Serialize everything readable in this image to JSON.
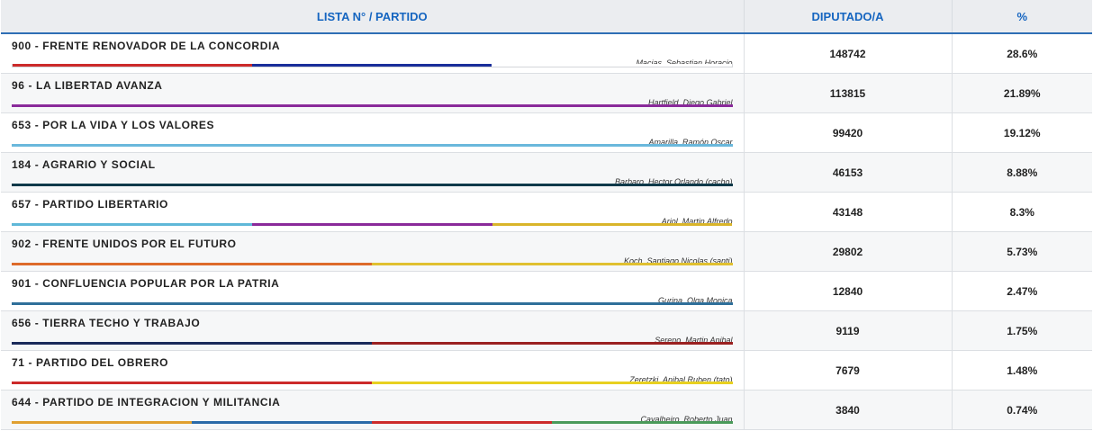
{
  "header": {
    "party_col": "LISTA N° / PARTIDO",
    "votes_col": "DIPUTADO/A",
    "pct_col": "%"
  },
  "rows": [
    {
      "party": "900 - FRENTE RENOVADOR DE LA CONCORDIA",
      "candidate": "Macias, Sebastian Horacio",
      "votes": "148742",
      "pct": "28.6%",
      "colors": [
        "#cc2a2a",
        "#1a2e9a",
        "#ffffff"
      ]
    },
    {
      "party": "96 - LA LIBERTAD AVANZA",
      "candidate": "Hartfield, Diego Gabriel",
      "votes": "113815",
      "pct": "21.89%",
      "colors": [
        "#8a2a9a"
      ]
    },
    {
      "party": "653 - POR LA VIDA Y LOS VALORES",
      "candidate": "Amarilla, Ramón Oscar",
      "votes": "99420",
      "pct": "19.12%",
      "colors": [
        "#6ab8dc"
      ]
    },
    {
      "party": "184 - AGRARIO Y SOCIAL",
      "candidate": "Barbaro, Hector Orlando (cacho)",
      "votes": "46153",
      "pct": "8.88%",
      "colors": [
        "#0f3a4a"
      ]
    },
    {
      "party": "657 - PARTIDO LIBERTARIO",
      "candidate": "Arjol, Martin Alfredo",
      "votes": "43148",
      "pct": "8.3%",
      "colors": [
        "#5fb8d8",
        "#8a2a9a",
        "#d9b52a"
      ]
    },
    {
      "party": "902 - FRENTE UNIDOS POR EL FUTURO",
      "candidate": "Koch, Santiago Nicolas (santi)",
      "votes": "29802",
      "pct": "5.73%",
      "colors": [
        "#dd6a2a",
        "#e0c030"
      ]
    },
    {
      "party": "901 - CONFLUENCIA POPULAR POR LA PATRIA",
      "candidate": "Gurina, Olga Monica",
      "votes": "12840",
      "pct": "2.47%",
      "colors": [
        "#2f6f9a"
      ]
    },
    {
      "party": "656 - TIERRA TECHO Y TRABAJO",
      "candidate": "Sereno, Martin Anibal",
      "votes": "9119",
      "pct": "1.75%",
      "colors": [
        "#1a2a5a",
        "#9a2020"
      ]
    },
    {
      "party": "71 - PARTIDO DEL OBRERO",
      "candidate": "Zeretzki, Anibal Ruben (tato)",
      "votes": "7679",
      "pct": "1.48%",
      "colors": [
        "#cc2a2a",
        "#e8d020"
      ]
    },
    {
      "party": "644 - PARTIDO DE INTEGRACION Y MILITANCIA",
      "candidate": "Cavalheiro, Roberto Juan",
      "votes": "3840",
      "pct": "0.74%",
      "colors": [
        "#e0a030",
        "#2a6aa8",
        "#cc2a2a",
        "#4a9a5a"
      ]
    }
  ]
}
